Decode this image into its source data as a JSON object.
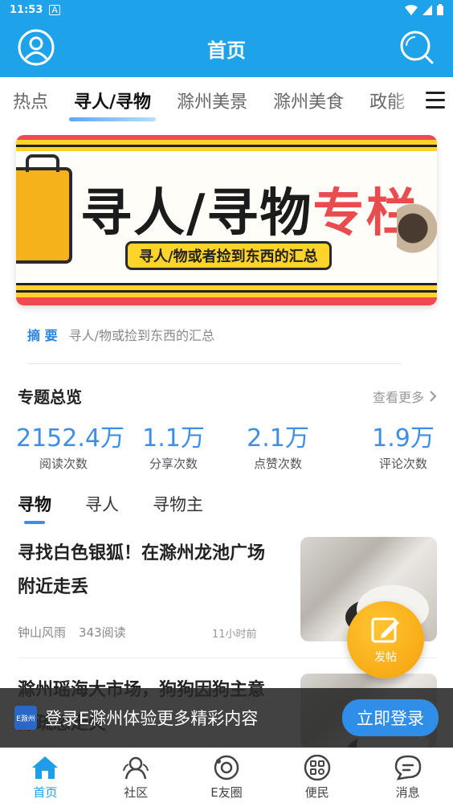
{
  "status_bar": {
    "time": "11:53",
    "notif_icon": "A"
  },
  "header": {
    "title": "首页"
  },
  "tabs": [
    {
      "label": "热点"
    },
    {
      "label": "寻人/寻物"
    },
    {
      "label": "滁州美景"
    },
    {
      "label": "滁州美食"
    },
    {
      "label": "政能"
    }
  ],
  "banner": {
    "headline_black": "寻人/寻物",
    "headline_red": "专栏",
    "subtitle": "寻人/物或者捡到东西的汇总"
  },
  "summary": {
    "label": "摘 要",
    "text": "寻人/物或捡到东西的汇总"
  },
  "overview": {
    "title": "专题总览",
    "more": "查看更多"
  },
  "stats": [
    {
      "num": "2152.4万",
      "label": "阅读次数"
    },
    {
      "num": "1.1万",
      "label": "分享次数"
    },
    {
      "num": "2.1万",
      "label": "点赞次数"
    },
    {
      "num": "1.9万",
      "label": "评论次数"
    }
  ],
  "subtabs": [
    {
      "label": "寻物"
    },
    {
      "label": "寻人"
    },
    {
      "label": "寻物主"
    }
  ],
  "articles": [
    {
      "title": "寻找白色银狐！在滁州龙池广场附近走丢",
      "author": "钟山风雨",
      "reads": "343阅读",
      "time": "11小时前"
    },
    {
      "title": "滁州瑶海大市场，狗狗因狗主意外疏忽走失",
      "author": "",
      "reads": "",
      "time": ""
    }
  ],
  "fab": {
    "label": "发帖"
  },
  "login_bar": {
    "logo_text": "E滁州",
    "text": "登录E滁州体验更多精彩内容",
    "button": "立即登录"
  },
  "bottom_nav": [
    {
      "label": "首页",
      "icon": "home-icon"
    },
    {
      "label": "社区",
      "icon": "community-icon"
    },
    {
      "label": "E友圈",
      "icon": "e-circle-icon"
    },
    {
      "label": "便民",
      "icon": "services-icon"
    },
    {
      "label": "消息",
      "icon": "message-icon"
    }
  ],
  "colors": {
    "primary": "#1ea2ea",
    "accent_blue": "#3f8ee6",
    "fab": "#f5a10a"
  }
}
